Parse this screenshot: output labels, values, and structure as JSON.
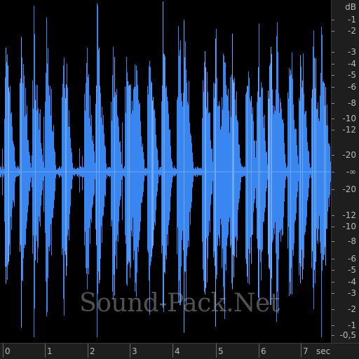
{
  "editor": {
    "db_unit": "dB",
    "time_unit": "sec",
    "waveform_color": "#3a86f0",
    "waveform_highlight": "#6aa8ff",
    "background_color": "#000000",
    "db_labels_top": [
      "-1",
      "-2",
      "-3",
      "-4",
      "-5",
      "-6",
      "-8",
      "-10",
      "-12",
      "-20"
    ],
    "db_center": "-∞",
    "db_labels_bottom": [
      "-20",
      "-12",
      "-10",
      "-8",
      "-6",
      "-5",
      "-4",
      "-3",
      "-2",
      "-1",
      "-0,5"
    ],
    "time_labels": [
      "0",
      "1",
      "2",
      "3",
      "4",
      "5",
      "6",
      "7"
    ],
    "watermark": "Sound-Pack.Net"
  }
}
